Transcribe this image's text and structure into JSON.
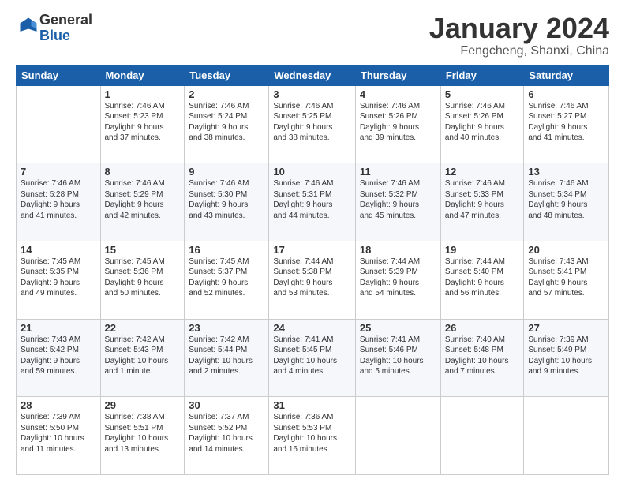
{
  "logo": {
    "general": "General",
    "blue": "Blue"
  },
  "header": {
    "title": "January 2024",
    "location": "Fengcheng, Shanxi, China"
  },
  "days_of_week": [
    "Sunday",
    "Monday",
    "Tuesday",
    "Wednesday",
    "Thursday",
    "Friday",
    "Saturday"
  ],
  "weeks": [
    [
      {
        "day": "",
        "info": ""
      },
      {
        "day": "1",
        "info": "Sunrise: 7:46 AM\nSunset: 5:23 PM\nDaylight: 9 hours\nand 37 minutes."
      },
      {
        "day": "2",
        "info": "Sunrise: 7:46 AM\nSunset: 5:24 PM\nDaylight: 9 hours\nand 38 minutes."
      },
      {
        "day": "3",
        "info": "Sunrise: 7:46 AM\nSunset: 5:25 PM\nDaylight: 9 hours\nand 38 minutes."
      },
      {
        "day": "4",
        "info": "Sunrise: 7:46 AM\nSunset: 5:26 PM\nDaylight: 9 hours\nand 39 minutes."
      },
      {
        "day": "5",
        "info": "Sunrise: 7:46 AM\nSunset: 5:26 PM\nDaylight: 9 hours\nand 40 minutes."
      },
      {
        "day": "6",
        "info": "Sunrise: 7:46 AM\nSunset: 5:27 PM\nDaylight: 9 hours\nand 41 minutes."
      }
    ],
    [
      {
        "day": "7",
        "info": "Sunrise: 7:46 AM\nSunset: 5:28 PM\nDaylight: 9 hours\nand 41 minutes."
      },
      {
        "day": "8",
        "info": "Sunrise: 7:46 AM\nSunset: 5:29 PM\nDaylight: 9 hours\nand 42 minutes."
      },
      {
        "day": "9",
        "info": "Sunrise: 7:46 AM\nSunset: 5:30 PM\nDaylight: 9 hours\nand 43 minutes."
      },
      {
        "day": "10",
        "info": "Sunrise: 7:46 AM\nSunset: 5:31 PM\nDaylight: 9 hours\nand 44 minutes."
      },
      {
        "day": "11",
        "info": "Sunrise: 7:46 AM\nSunset: 5:32 PM\nDaylight: 9 hours\nand 45 minutes."
      },
      {
        "day": "12",
        "info": "Sunrise: 7:46 AM\nSunset: 5:33 PM\nDaylight: 9 hours\nand 47 minutes."
      },
      {
        "day": "13",
        "info": "Sunrise: 7:46 AM\nSunset: 5:34 PM\nDaylight: 9 hours\nand 48 minutes."
      }
    ],
    [
      {
        "day": "14",
        "info": "Sunrise: 7:45 AM\nSunset: 5:35 PM\nDaylight: 9 hours\nand 49 minutes."
      },
      {
        "day": "15",
        "info": "Sunrise: 7:45 AM\nSunset: 5:36 PM\nDaylight: 9 hours\nand 50 minutes."
      },
      {
        "day": "16",
        "info": "Sunrise: 7:45 AM\nSunset: 5:37 PM\nDaylight: 9 hours\nand 52 minutes."
      },
      {
        "day": "17",
        "info": "Sunrise: 7:44 AM\nSunset: 5:38 PM\nDaylight: 9 hours\nand 53 minutes."
      },
      {
        "day": "18",
        "info": "Sunrise: 7:44 AM\nSunset: 5:39 PM\nDaylight: 9 hours\nand 54 minutes."
      },
      {
        "day": "19",
        "info": "Sunrise: 7:44 AM\nSunset: 5:40 PM\nDaylight: 9 hours\nand 56 minutes."
      },
      {
        "day": "20",
        "info": "Sunrise: 7:43 AM\nSunset: 5:41 PM\nDaylight: 9 hours\nand 57 minutes."
      }
    ],
    [
      {
        "day": "21",
        "info": "Sunrise: 7:43 AM\nSunset: 5:42 PM\nDaylight: 9 hours\nand 59 minutes."
      },
      {
        "day": "22",
        "info": "Sunrise: 7:42 AM\nSunset: 5:43 PM\nDaylight: 10 hours\nand 1 minute."
      },
      {
        "day": "23",
        "info": "Sunrise: 7:42 AM\nSunset: 5:44 PM\nDaylight: 10 hours\nand 2 minutes."
      },
      {
        "day": "24",
        "info": "Sunrise: 7:41 AM\nSunset: 5:45 PM\nDaylight: 10 hours\nand 4 minutes."
      },
      {
        "day": "25",
        "info": "Sunrise: 7:41 AM\nSunset: 5:46 PM\nDaylight: 10 hours\nand 5 minutes."
      },
      {
        "day": "26",
        "info": "Sunrise: 7:40 AM\nSunset: 5:48 PM\nDaylight: 10 hours\nand 7 minutes."
      },
      {
        "day": "27",
        "info": "Sunrise: 7:39 AM\nSunset: 5:49 PM\nDaylight: 10 hours\nand 9 minutes."
      }
    ],
    [
      {
        "day": "28",
        "info": "Sunrise: 7:39 AM\nSunset: 5:50 PM\nDaylight: 10 hours\nand 11 minutes."
      },
      {
        "day": "29",
        "info": "Sunrise: 7:38 AM\nSunset: 5:51 PM\nDaylight: 10 hours\nand 13 minutes."
      },
      {
        "day": "30",
        "info": "Sunrise: 7:37 AM\nSunset: 5:52 PM\nDaylight: 10 hours\nand 14 minutes."
      },
      {
        "day": "31",
        "info": "Sunrise: 7:36 AM\nSunset: 5:53 PM\nDaylight: 10 hours\nand 16 minutes."
      },
      {
        "day": "",
        "info": ""
      },
      {
        "day": "",
        "info": ""
      },
      {
        "day": "",
        "info": ""
      }
    ]
  ]
}
